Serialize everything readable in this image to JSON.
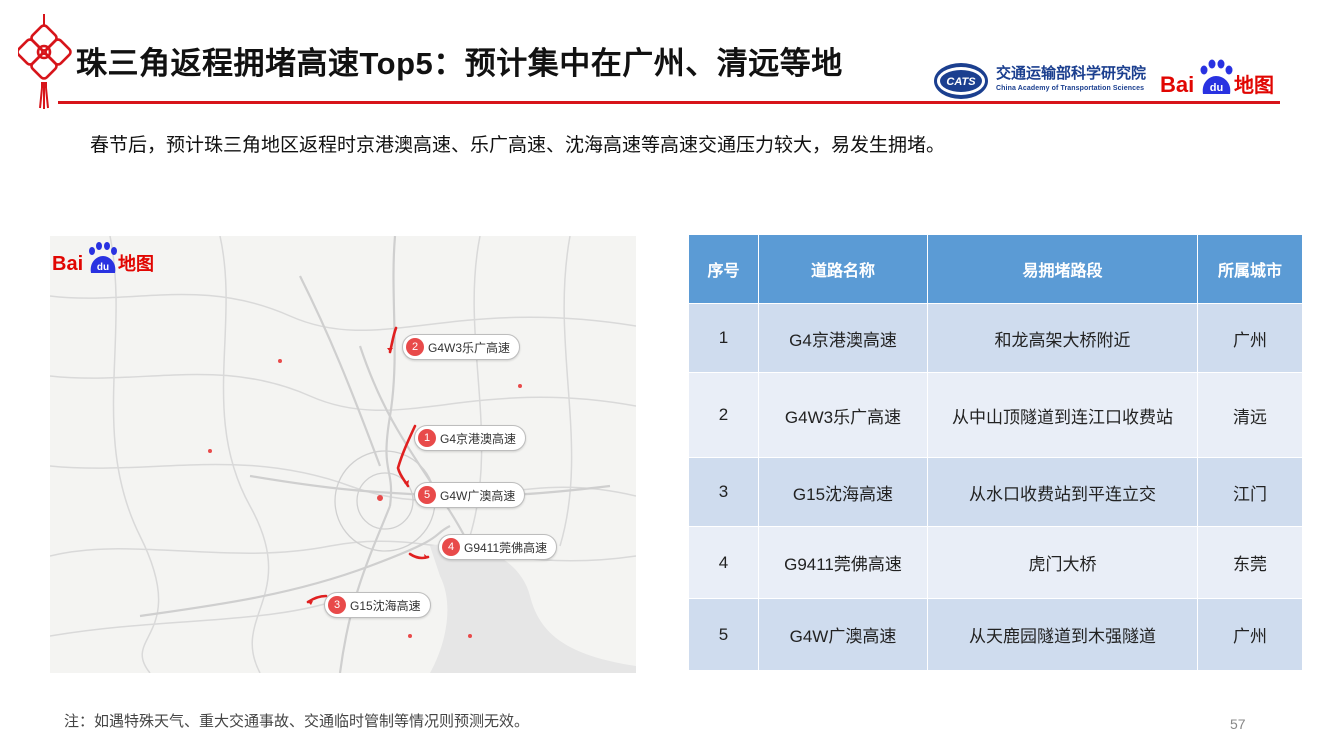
{
  "header": {
    "title": "珠三角返程拥堵高速Top5：预计集中在广州、清远等地",
    "org_name_cn": "交通运输部科学研究院",
    "org_name_en": "China Academy of Transportation Sciences",
    "org_logo_text": "CATS",
    "brand_logo_text": "Bai地图",
    "colors": {
      "accent_red": "#d7141a",
      "org_blue": "#1b3f8f",
      "baidu_blue": "#2932e1",
      "baidu_red": "#e10602"
    }
  },
  "subtitle": "春节后，预计珠三角地区返程时京港澳高速、乐广高速、沈海高速等高速交通压力较大，易发生拥堵。",
  "map": {
    "logo_text": "Bai地图",
    "markers": [
      {
        "num": "2",
        "label": "G4W3乐广高速"
      },
      {
        "num": "1",
        "label": "G4京港澳高速"
      },
      {
        "num": "5",
        "label": "G4W广澳高速"
      },
      {
        "num": "4",
        "label": "G9411莞佛高速"
      },
      {
        "num": "3",
        "label": "G15沈海高速"
      }
    ]
  },
  "table": {
    "headers": [
      "序号",
      "道路名称",
      "易拥堵路段",
      "所属城市"
    ],
    "rows": [
      [
        "1",
        "G4京港澳高速",
        "和龙高架大桥附近",
        "广州"
      ],
      [
        "2",
        "G4W3乐广高速",
        "从中山顶隧道到连江口收费站",
        "清远"
      ],
      [
        "3",
        "G15沈海高速",
        "从水口收费站到平连立交",
        "江门"
      ],
      [
        "4",
        "G9411莞佛高速",
        "虎门大桥",
        "东莞"
      ],
      [
        "5",
        "G4W广澳高速",
        "从天鹿园隧道到木强隧道",
        "广州"
      ]
    ],
    "colors": {
      "header_bg": "#5b9bd5",
      "row_dark": "#cfdcee",
      "row_light": "#e9eef7"
    }
  },
  "footnote": "注：如遇特殊天气、重大交通事故、交通临时管制等情况则预测无效。",
  "page_number": "57"
}
